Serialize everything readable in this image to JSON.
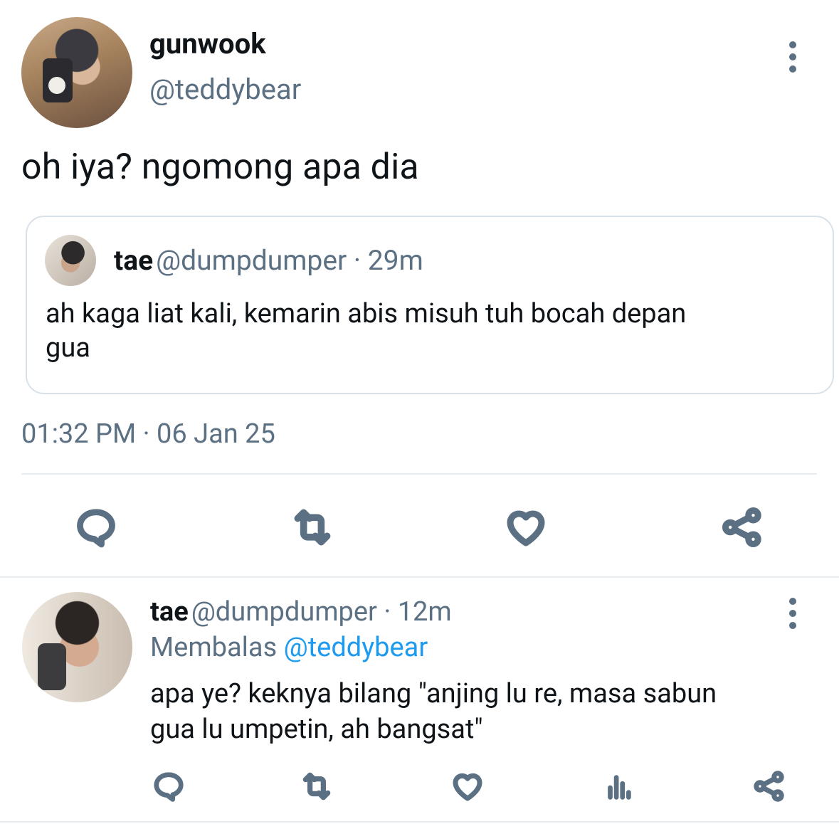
{
  "main_tweet": {
    "author_name": "gunwook",
    "author_handle": "@teddybear",
    "text": "oh iya? ngomong apa dia",
    "timestamp": "01:32 PM · 06 Jan 25"
  },
  "quoted_tweet": {
    "author_name": "tae",
    "meta": "@dumpdumper · 29m",
    "text_line1": "ah kaga liat kali, kemarin abis misuh tuh bocah depan",
    "text_line2": "gua"
  },
  "reply": {
    "author_name": "tae",
    "meta": "@dumpdumper · 12m",
    "replying_label": "Membalas",
    "replying_to": "@teddybear",
    "text_line1": "apa ye? keknya bilang \"anjing lu re, masa sabun",
    "text_line2": "gua lu umpetin, ah bangsat\""
  },
  "icons": {
    "reply": "reply-icon",
    "retweet": "retweet-icon",
    "like": "heart-icon",
    "share": "share-icon",
    "views": "views-icon",
    "more": "more-vertical-icon"
  },
  "colors": {
    "text": "#0f1419",
    "secondary": "#5b7083",
    "link": "#1d9bf0",
    "border": "#d9e1e8"
  }
}
